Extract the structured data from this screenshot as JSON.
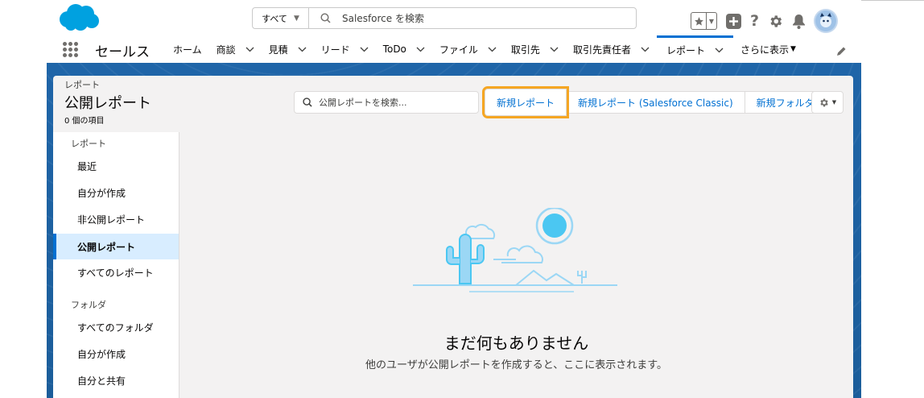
{
  "colors": {
    "brand": "#0070d2",
    "highlight": "#f5a623",
    "header_bg": "#1b5f9e"
  },
  "global_header": {
    "scope_label": "すべて",
    "search_placeholder": "Salesforce を検索",
    "icons": [
      "star-icon",
      "add-icon",
      "help-icon",
      "setup-gear-icon",
      "notification-bell-icon",
      "user-avatar"
    ]
  },
  "nav": {
    "app_name": "セールス",
    "items": [
      {
        "label": "ホーム"
      },
      {
        "label": "商談"
      },
      {
        "label": "見積"
      },
      {
        "label": "リード"
      },
      {
        "label": "ToDo"
      },
      {
        "label": "ファイル"
      },
      {
        "label": "取引先"
      },
      {
        "label": "取引先責任者"
      },
      {
        "label": "レポート"
      },
      {
        "label": "さらに表示"
      }
    ]
  },
  "list_header": {
    "breadcrumb": "レポート",
    "title": "公開レポート",
    "count": "0 個の項目",
    "search_placeholder": "公開レポートを検索...",
    "buttons": {
      "new_report": "新規レポート",
      "new_report_classic": "新規レポート (Salesforce Classic)",
      "new_folder": "新規フォルダ"
    }
  },
  "sidebar": {
    "reports_heading": "レポート",
    "report_items": [
      "最近",
      "自分が作成",
      "非公開レポート",
      "公開レポート",
      "すべてのレポート"
    ],
    "folders_heading": "フォルダ",
    "folder_items": [
      "すべてのフォルダ",
      "自分が作成",
      "自分と共有"
    ]
  },
  "empty_state": {
    "title": "まだ何もありません",
    "subtitle": "他のユーザが公開レポートを作成すると、ここに表示されます。"
  }
}
